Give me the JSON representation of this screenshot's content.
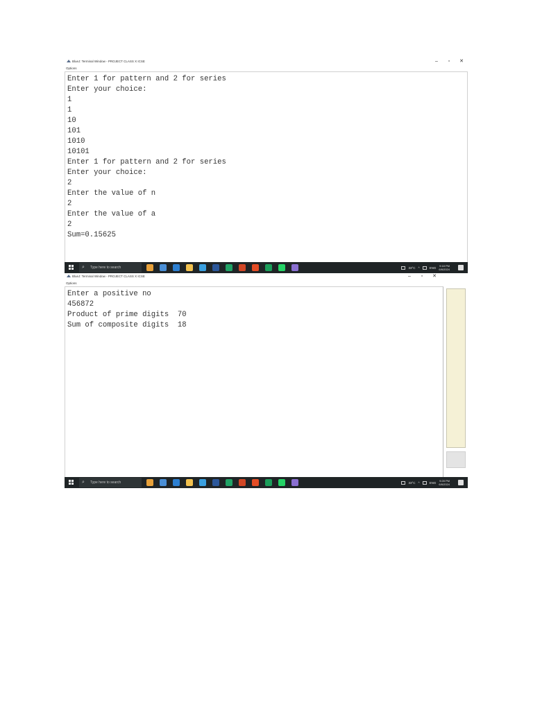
{
  "screenshots": [
    {
      "window": {
        "title": "BlueJ: Terminal Window - PROJECT CLASS X ICSE",
        "minimize": "–",
        "maximize": "▫",
        "close": "✕",
        "menu": "Options"
      },
      "terminal_lines": [
        "Enter 1 for pattern and 2 for series",
        "Enter your choice:",
        "1",
        "1",
        "10",
        "101",
        "1010",
        "10101",
        "Enter 1 for pattern and 2 for series",
        "Enter your choice:",
        "2",
        "Enter the value of n",
        "2",
        "Enter the value of a",
        "2",
        "Sum=0.15625"
      ],
      "taskbar": {
        "search_placeholder": "Type here to search",
        "temperature": "33°C",
        "language": "ENG",
        "time": "9:18 PM",
        "date": "6/6/2024"
      }
    },
    {
      "window": {
        "title": "BlueJ: Terminal Window - PROJECT CLASS X ICSE",
        "minimize": "–",
        "maximize": "▫",
        "close": "✕",
        "menu": "Options"
      },
      "terminal_lines": [
        "Enter a positive no",
        "456872",
        "Product of prime digits  70",
        "Sum of composite digits  18"
      ],
      "taskbar": {
        "search_placeholder": "Type here to search",
        "temperature": "33°C",
        "language": "ENG",
        "time": "9:28 PM",
        "date": "6/6/2024"
      }
    }
  ],
  "colors": {
    "taskbar_bg": "#1f2426",
    "terminal_text": "#333333",
    "app_icons": [
      "#e8a13a",
      "#4a8fd6",
      "#2c7fd1",
      "#f2c14e",
      "#3aa0e0",
      "#2b579a",
      "#21a366",
      "#d24726",
      "#e44d26",
      "#1b9e5a",
      "#25d366",
      "#8a6fd1"
    ]
  }
}
